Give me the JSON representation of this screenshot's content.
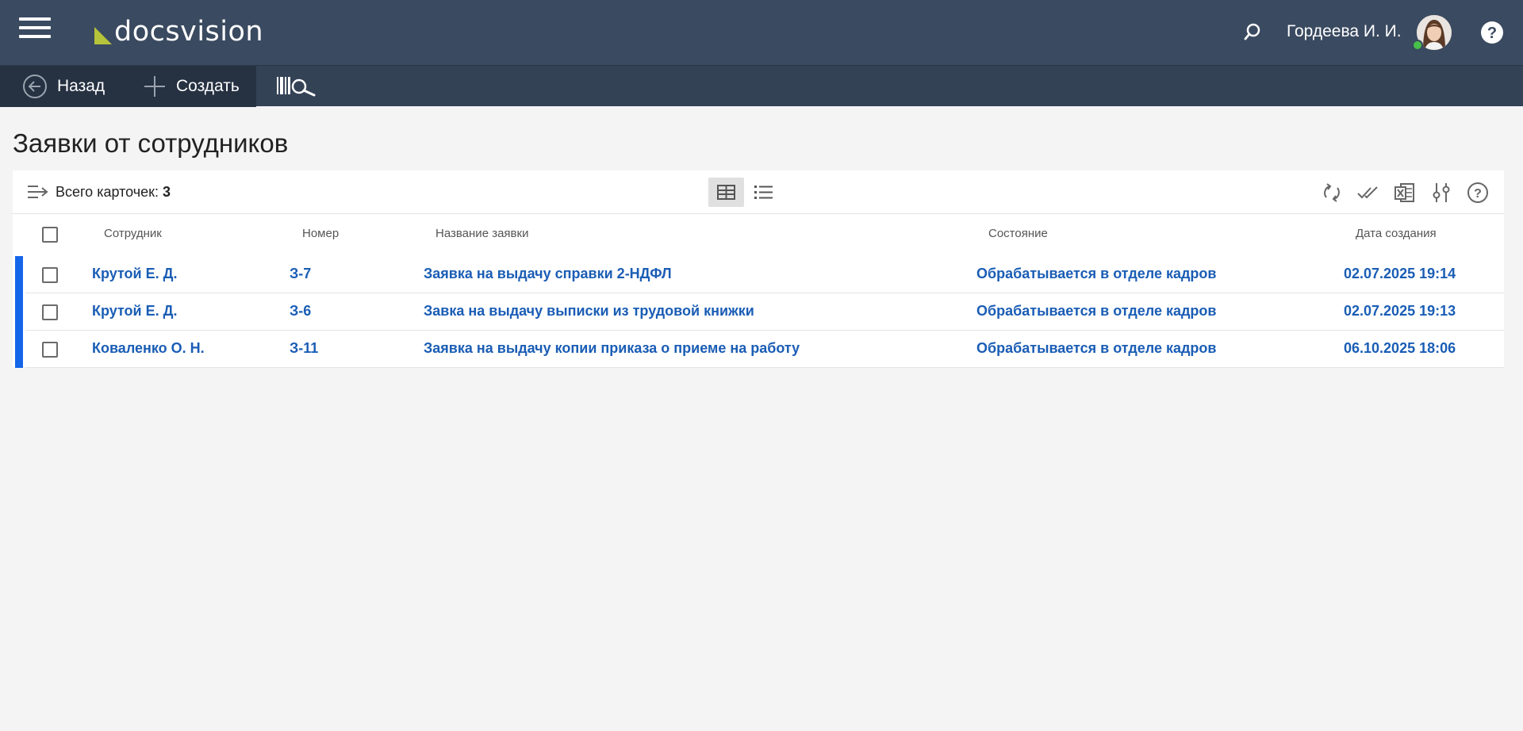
{
  "header": {
    "logo_text": "docsvision",
    "user_name": "Гордеева И. И.",
    "icons": [
      "hamburger-menu-icon",
      "search-icon",
      "avatar",
      "help-icon"
    ]
  },
  "toolbar": {
    "back_label": "Назад",
    "create_label": "Создать",
    "barcode_search_icon": "barcode-search-icon"
  },
  "page": {
    "title": "Заявки от сотрудников"
  },
  "panel": {
    "total_label": "Всего карточек:",
    "total_count": "3",
    "tools": [
      "refresh-icon",
      "check-all-icon",
      "excel-export-icon",
      "settings-icon",
      "help-icon"
    ]
  },
  "table": {
    "columns": [
      "Сотрудник",
      "Номер",
      "Название заявки",
      "Состояние",
      "Дата создания"
    ],
    "rows": [
      {
        "employee": "Крутой Е. Д.",
        "number": "З-7",
        "title": "Заявка на выдачу справки 2-НДФЛ",
        "state": "Обрабатывается в отделе кадров",
        "date": "02.07.2025 19:14"
      },
      {
        "employee": "Крутой Е. Д.",
        "number": "З-6",
        "title": "Завка на выдачу выписки из трудовой книжки",
        "state": "Обрабатывается в отделе кадров",
        "date": "02.07.2025 19:13"
      },
      {
        "employee": "Коваленко О. Н.",
        "number": "З-11",
        "title": "Заявка на выдачу копии приказа о приеме на работу",
        "state": "Обрабатывается в отделе кадров",
        "date": "06.10.2025 18:06"
      }
    ]
  },
  "colors": {
    "header_bg": "#3a4a60",
    "toolbar_bg": "#344256",
    "link": "#1a5db5",
    "row_marker": "#1565e8",
    "logo_accent": "#b5c43a",
    "online": "#47c04a"
  }
}
